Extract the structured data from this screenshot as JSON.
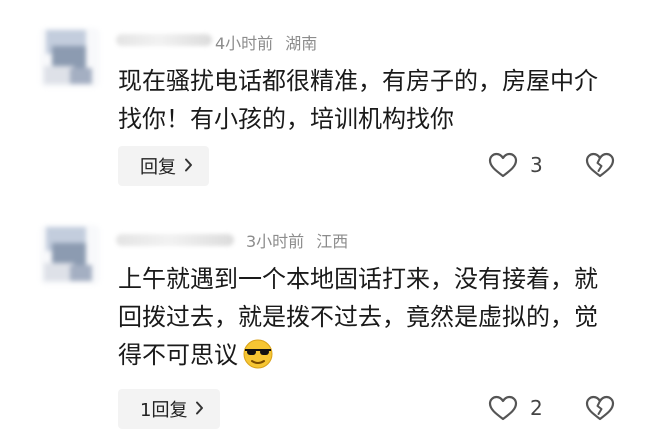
{
  "comments": [
    {
      "time": "4小时前",
      "location": "湖南",
      "text": "现在骚扰电话都很精准，有房子的，房屋中介找你！有小孩的，培训机构找你",
      "reply_label": "回复",
      "likes": "3",
      "avatar_icon": "blurred-avatar",
      "like_icon": "heart-outline",
      "dislike_icon": "broken-heart-outline"
    },
    {
      "time": "3小时前",
      "location": "江西",
      "text": "上午就遇到一个本地固话打来，没有接着，就回拨过去，就是拨不过去，竟然是虚拟的，觉得不可思议",
      "emoji_icon": "sunglasses-face-emoji",
      "reply_label": "1回复",
      "likes": "2",
      "avatar_icon": "blurred-avatar",
      "like_icon": "heart-outline",
      "dislike_icon": "broken-heart-outline"
    }
  ],
  "colors": {
    "meta": "#8c8c8c",
    "text": "#1a1a1a",
    "reply_bg": "#f3f3f3",
    "emoji_yellow": "#f6c633"
  }
}
